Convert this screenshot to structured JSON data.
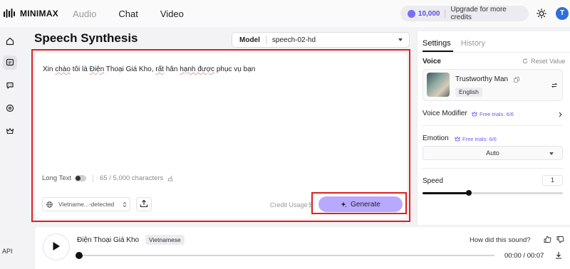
{
  "app": {
    "logo_text": "MINIMAX",
    "nav": [
      "Audio",
      "Chat",
      "Video"
    ],
    "credits": "10,000",
    "upgrade_label": "Upgrade for more credits",
    "avatar_initial": "T",
    "icons": {
      "theme": "sun-icon",
      "credit": "credit-coin-icon"
    }
  },
  "sidebar": {
    "items": [
      "home-icon",
      "speech-icon",
      "chat-icon",
      "voice-clone-icon",
      "crown-icon"
    ],
    "active_index": 1,
    "api_label": "API"
  },
  "main": {
    "title": "Speech Synthesis",
    "model_label": "Model",
    "model_value": "speech-02-hd",
    "editor_text": {
      "p1": "Xin ",
      "p2": "chào",
      "p3": " tôi là ",
      "p4": "Điện",
      "p5": " Thoại Giá Kho, ",
      "p6": "rất",
      "p7": " hân ",
      "p8": "hạnh được",
      "p9": " phục vụ bạn"
    },
    "long_text_label": "Long Text",
    "char_count": "65 / 5,000 characters",
    "language_select": "Vietname...-detected",
    "credit_usage_label": "Credit Usage",
    "credit_usage_value": "$",
    "generate_label": "Generate"
  },
  "settings": {
    "tabs": [
      "Settings",
      "History"
    ],
    "active_tab": "Settings",
    "voice_label": "Voice",
    "reset_label": "Reset Value",
    "voice_name": "Trustworthy Man",
    "voice_lang": "English",
    "voice_modifier_label": "Voice Modifier",
    "emotion_label": "Emotion",
    "free_trials": "Free trials: 6/6",
    "emotion_value": "Auto",
    "speed_label": "Speed",
    "speed_value": "1",
    "speed_fraction": 0.33
  },
  "player": {
    "title": "Điện Thoại Giá Kho",
    "language": "Vietnamese",
    "feedback_prompt": "How did this sound?",
    "time": "00:00 / 00:07",
    "progress": 0
  },
  "colors": {
    "accent": "#b8a9ff",
    "brand_purple": "#6b5be6",
    "highlight_red": "#e01e1e"
  }
}
